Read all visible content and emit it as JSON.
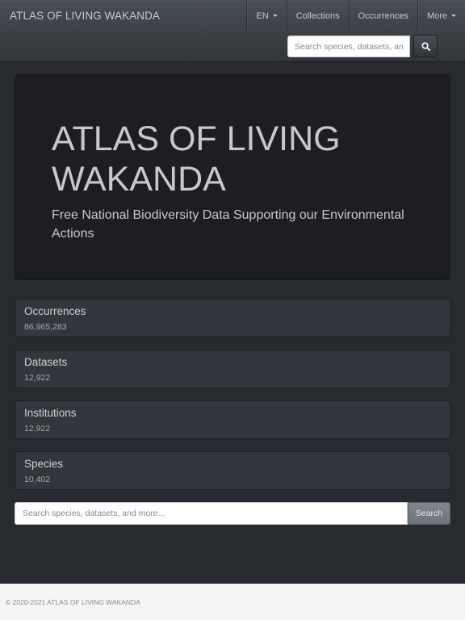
{
  "navbar": {
    "brand": "ATLAS OF LIVING WAKANDA",
    "language": "EN",
    "items": [
      {
        "label": "Collections"
      },
      {
        "label": "Occurrences"
      },
      {
        "label": "More"
      }
    ],
    "search_placeholder": "Search species, datasets, and more..."
  },
  "hero": {
    "title": "ATLAS OF LIVING WAKANDA",
    "subtitle": "Free National Biodiversity Data Supporting our Environmental Actions"
  },
  "stats": [
    {
      "label": "Occurrences",
      "value": "86,965,283"
    },
    {
      "label": "Datasets",
      "value": "12,922"
    },
    {
      "label": "Institutions",
      "value": "12,922"
    },
    {
      "label": "Species",
      "value": "10,402"
    }
  ],
  "search": {
    "placeholder": "Search species, datasets, and more...",
    "button_label": "Search"
  },
  "footer": {
    "copyright": "© 2020-2021 ATLAS OF LIVING WAKANDA"
  },
  "icons": {
    "nav_search": "search-icon",
    "dropdown": "chevron-down-icon"
  },
  "colors": {
    "background": "#272b30",
    "navbar": "#3a3f44",
    "hero": "#1c1e22",
    "card": "#32373d",
    "search_button": "#7a8288",
    "footer": "#f5f5f5"
  }
}
